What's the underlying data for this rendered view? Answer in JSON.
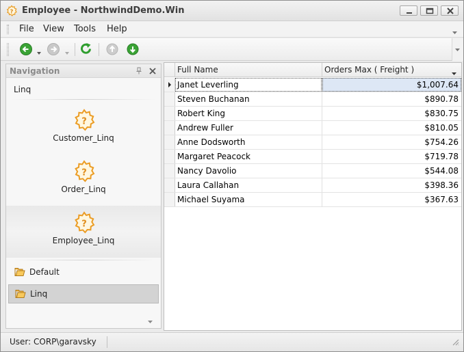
{
  "window": {
    "title": "Employee - NorthwindDemo.Win",
    "icon": "gear-question-icon",
    "controls": [
      "minimize-icon",
      "maximize-icon",
      "close-icon"
    ]
  },
  "menu": {
    "items": [
      "File",
      "View",
      "Tools",
      "Help"
    ]
  },
  "toolbar": {
    "buttons": [
      "back-icon",
      "forward-icon",
      "refresh-icon",
      "previous-record-icon",
      "next-record-icon"
    ]
  },
  "navigation": {
    "title": "Navigation",
    "group_title": "Linq",
    "items": [
      {
        "label": "Customer_Linq",
        "icon": "gear-question-icon",
        "selected": false
      },
      {
        "label": "Order_Linq",
        "icon": "gear-question-icon",
        "selected": false
      },
      {
        "label": "Employee_Linq",
        "icon": "gear-question-icon",
        "selected": true
      }
    ],
    "groups": [
      {
        "label": "Default",
        "icon": "folder-icon",
        "active": false
      },
      {
        "label": "Linq",
        "icon": "folder-icon",
        "active": true
      }
    ]
  },
  "grid": {
    "columns": [
      "Full Name",
      "Orders Max ( Freight )"
    ],
    "rows": [
      {
        "name": "Janet Leverling",
        "value": "$1,007.64"
      },
      {
        "name": "Steven Buchanan",
        "value": "$890.78"
      },
      {
        "name": "Robert King",
        "value": "$830.75"
      },
      {
        "name": "Andrew Fuller",
        "value": "$810.05"
      },
      {
        "name": "Anne Dodsworth",
        "value": "$754.26"
      },
      {
        "name": "Margaret Peacock",
        "value": "$719.78"
      },
      {
        "name": "Nancy Davolio",
        "value": "$544.08"
      },
      {
        "name": "Laura Callahan",
        "value": "$398.36"
      },
      {
        "name": "Michael Suyama",
        "value": "$367.63"
      }
    ]
  },
  "status": {
    "user": "User: CORP\\garavsky"
  },
  "colors": {
    "accent_orange": "#f0a830",
    "nav_green": "#3aa335",
    "selection_blue": "#dde7f5"
  }
}
